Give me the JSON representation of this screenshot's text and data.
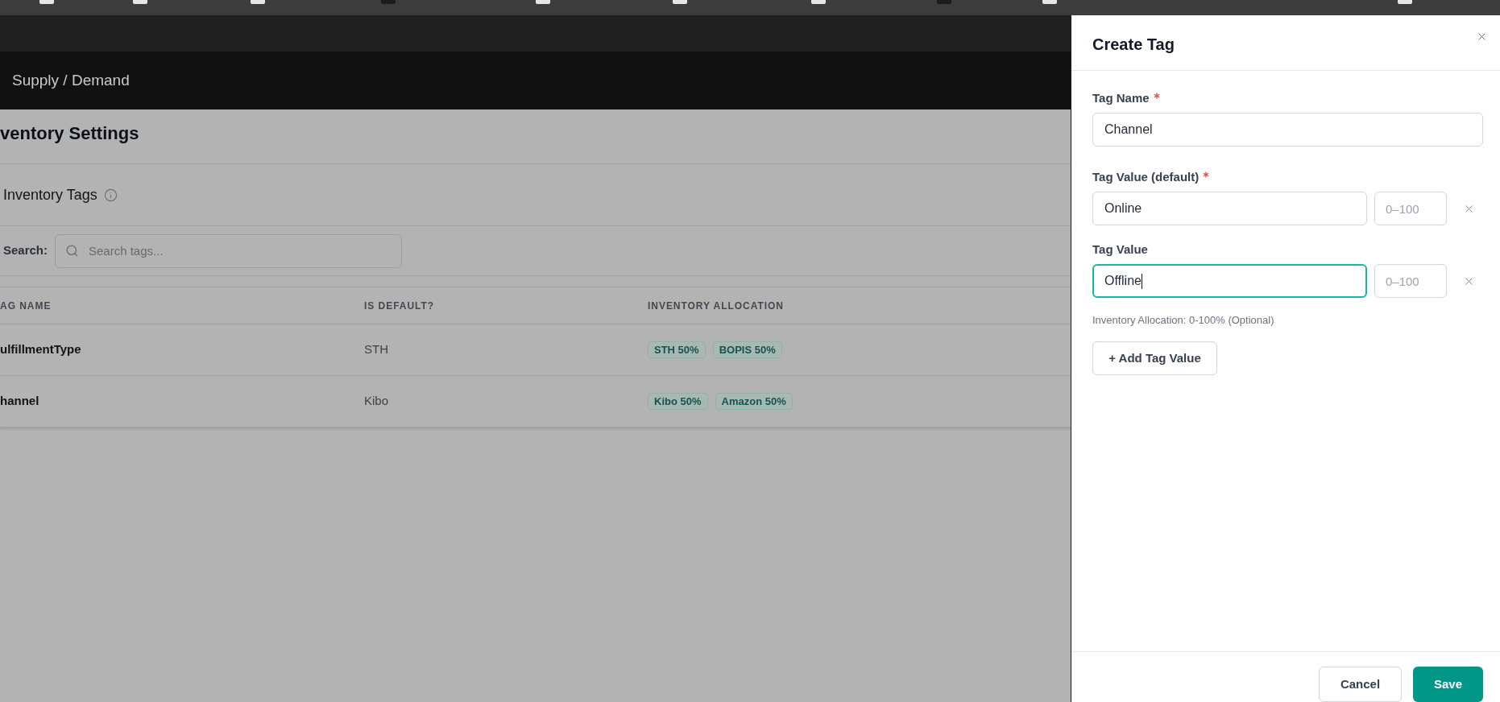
{
  "top_bar": {
    "breadcrumb": "Supply / Demand"
  },
  "page": {
    "title": "ventory Settings",
    "section_title": "Inventory Tags",
    "search": {
      "label": "Search:",
      "placeholder": "Search tags..."
    },
    "table": {
      "columns": [
        "AG NAME",
        "IS DEFAULT?",
        "INVENTORY ALLOCATION"
      ],
      "rows": [
        {
          "tag_name": "ulfillmentType",
          "is_default": "STH",
          "allocation": [
            "STH 50%",
            "BOPIS 50%"
          ]
        },
        {
          "tag_name": "hannel",
          "is_default": "Kibo",
          "allocation": [
            "Kibo 50%",
            "Amazon 50%"
          ]
        }
      ]
    }
  },
  "drawer": {
    "title": "Create Tag",
    "tag_name": {
      "label": "Tag Name",
      "required": true,
      "value": "Channel"
    },
    "tag_values": [
      {
        "label": "Tag Value (default)",
        "required": true,
        "value": "Online",
        "allocation_placeholder": "0–100",
        "focused": false
      },
      {
        "label": "Tag Value",
        "required": false,
        "value": "Offline",
        "allocation_placeholder": "0–100",
        "focused": true
      }
    ],
    "helper_text": "Inventory Allocation: 0-100% (Optional)",
    "add_button": "+ Add Tag Value",
    "footer_buttons": [
      {
        "label": "Cancel",
        "kind": "secondary"
      },
      {
        "label": "Save",
        "kind": "primary"
      }
    ]
  }
}
